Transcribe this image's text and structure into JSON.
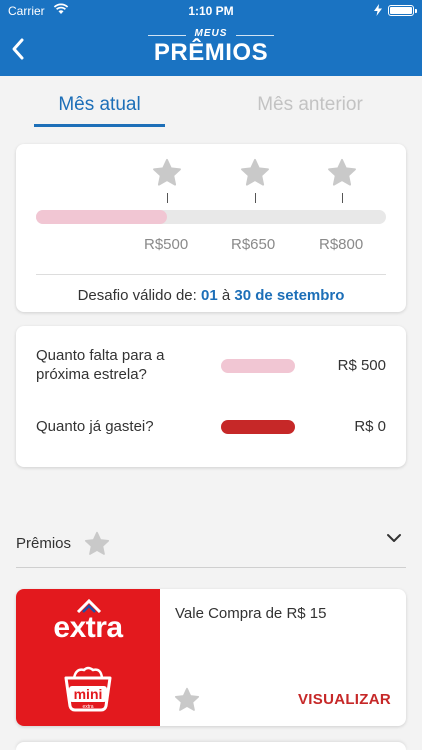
{
  "status_bar": {
    "carrier": "Carrier",
    "time": "1:10 PM"
  },
  "header": {
    "logo_small": "MEUS",
    "logo_main": "PRÊMIOS"
  },
  "tabs": [
    {
      "label": "Mês atual",
      "active": true
    },
    {
      "label": "Mês anterior",
      "active": false
    }
  ],
  "progress": {
    "fraction": 0.375,
    "milestones": [
      "R$500",
      "R$650",
      "R$800"
    ],
    "challenge_prefix": "Desafio válido de:",
    "start_day": "01",
    "connector": "à",
    "end_date": "30 de setembro"
  },
  "summary": {
    "next_star_label": "Quanto falta para a próxima estrela?",
    "next_star_value": "R$ 500",
    "spent_label": "Quanto já gastei?",
    "spent_value": "R$ 0"
  },
  "prizes": {
    "title": "Prêmios",
    "items": [
      {
        "brand": "extra",
        "brand_sub": "mini",
        "brand_small": "extra",
        "name": "Vale Compra de R$ 15",
        "action": "VISUALIZAR"
      }
    ]
  },
  "colors": {
    "brand_blue": "#1a73c2",
    "accent_blue": "#1d6fb8",
    "pink": "#f1c6d3",
    "red": "#c62828",
    "extra_red": "#e3191e"
  }
}
